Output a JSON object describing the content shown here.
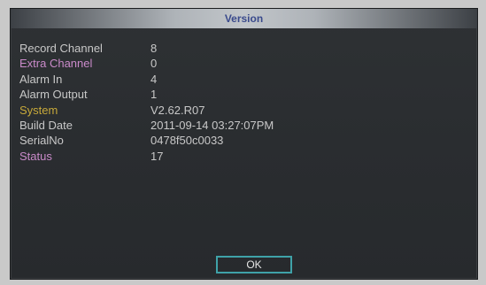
{
  "dialog": {
    "title": "Version",
    "title_color": "#3a4a8c"
  },
  "info": {
    "rows": [
      {
        "label": "Record Channel",
        "value": "8",
        "label_color": "#c8c8c8"
      },
      {
        "label": "Extra Channel",
        "value": "0",
        "label_color": "#c98ac9"
      },
      {
        "label": "Alarm In",
        "value": "4",
        "label_color": "#c8c8c8"
      },
      {
        "label": "Alarm Output",
        "value": "1",
        "label_color": "#c8c8c8"
      },
      {
        "label": "System",
        "value": "V2.62.R07",
        "label_color": "#c7a93a"
      },
      {
        "label": "Build Date",
        "value": "2011-09-14 03:27:07PM",
        "label_color": "#c8c8c8"
      },
      {
        "label": "SerialNo",
        "value": "0478f50c0033",
        "label_color": "#c8c8c8"
      },
      {
        "label": "Status",
        "value": "17",
        "label_color": "#c98ac9"
      }
    ]
  },
  "buttons": {
    "ok_label": "OK",
    "ok_border_color": "#3fa2a8"
  }
}
